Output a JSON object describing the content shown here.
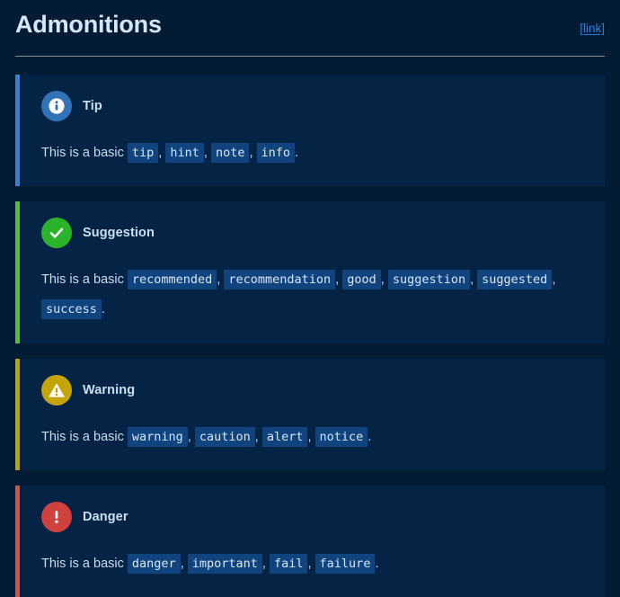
{
  "header": {
    "title": "Admonitions",
    "link_label": "[link]"
  },
  "colors": {
    "page_background": "#041c33",
    "admonition_background": "#042345",
    "code_background": "#11437e",
    "link": "#2b7fd4",
    "rule": "#8a8f94",
    "tip_accent": "#3b7dd8",
    "suggestion_accent": "#4fc140",
    "warning_accent": "#bfa100",
    "danger_accent": "#d7504a"
  },
  "admonitions": [
    {
      "type": "tip",
      "icon": "info-circle-icon",
      "title": "Tip",
      "lead": "This is a basic ",
      "keywords": [
        "tip",
        "hint",
        "note",
        "info"
      ],
      "trailing": "."
    },
    {
      "type": "suggestion",
      "icon": "check-circle-icon",
      "title": "Suggestion",
      "lead": "This is a basic ",
      "keywords": [
        "recommended",
        "recommendation",
        "good",
        "suggestion",
        "suggested",
        "success"
      ],
      "trailing": "."
    },
    {
      "type": "warning",
      "icon": "warning-triangle-icon",
      "title": "Warning",
      "lead": "This is a basic ",
      "keywords": [
        "warning",
        "caution",
        "alert",
        "notice"
      ],
      "trailing": "."
    },
    {
      "type": "danger",
      "icon": "exclamation-circle-icon",
      "title": "Danger",
      "lead": "This is a basic ",
      "keywords": [
        "danger",
        "important",
        "fail",
        "failure"
      ],
      "trailing": "."
    }
  ],
  "separator": ", "
}
